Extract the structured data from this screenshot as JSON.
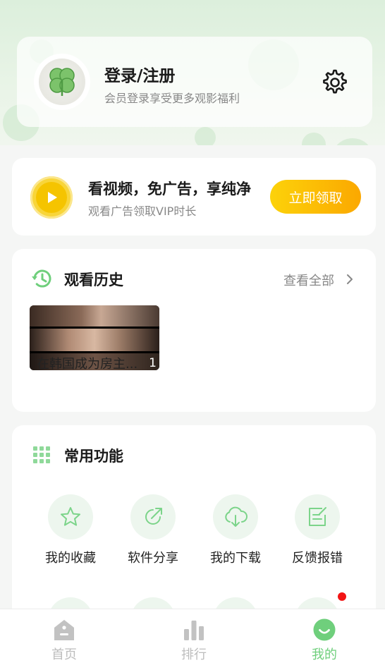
{
  "profile": {
    "title": "登录/注册",
    "subtitle": "会员登录享受更多观影福利"
  },
  "ad": {
    "title": "看视频，免广告，享纯净",
    "subtitle": "观看广告领取VIP时长",
    "button": "立即领取"
  },
  "history": {
    "title": "观看历史",
    "see_all": "查看全部",
    "items": [
      {
        "title": "在韩国成为房主...",
        "episode": "1"
      }
    ]
  },
  "functions": {
    "title": "常用功能",
    "items": [
      {
        "label": "我的收藏",
        "icon": "star-icon"
      },
      {
        "label": "软件分享",
        "icon": "share-icon"
      },
      {
        "label": "我的下载",
        "icon": "cloud-download-icon"
      },
      {
        "label": "反馈报错",
        "icon": "feedback-icon"
      }
    ]
  },
  "tabs": [
    {
      "label": "首页",
      "icon": "home-icon",
      "active": false
    },
    {
      "label": "排行",
      "icon": "chart-icon",
      "active": false
    },
    {
      "label": "我的",
      "icon": "smile-icon",
      "active": true
    }
  ],
  "colors": {
    "accent": "#6fcf7c",
    "button_start": "#fcd20a",
    "button_end": "#fba800",
    "notification": "#f21414"
  }
}
